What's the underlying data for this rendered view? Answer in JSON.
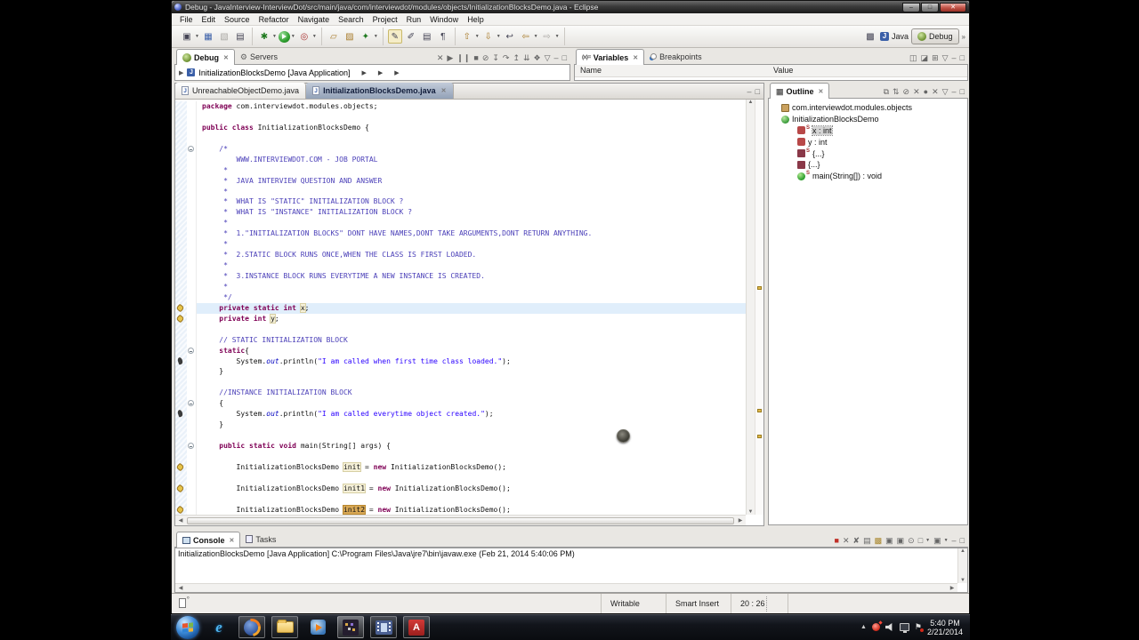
{
  "window": {
    "title": "Debug - JavaInterview-InterviewDot/src/main/java/com/interviewdot/modules/objects/InitializationBlocksDemo.java - Eclipse"
  },
  "menu_items": [
    "File",
    "Edit",
    "Source",
    "Refactor",
    "Navigate",
    "Search",
    "Project",
    "Run",
    "Window",
    "Help"
  ],
  "toolbar": {
    "perspective_java": "Java",
    "perspective_debug": "Debug",
    "overflow": "»"
  },
  "debug_panel": {
    "tab_debug": "Debug",
    "tab_servers": "Servers",
    "process_label": "InitializationBlocksDemo [Java Application]"
  },
  "variables_panel": {
    "tab_variables": "Variables",
    "tab_breakpoints": "Breakpoints",
    "col_name": "Name",
    "col_value": "Value"
  },
  "editor": {
    "tab_inactive": "UnreachableObjectDemo.java",
    "tab_active": "InitializationBlocksDemo.java",
    "code": {
      "markers": {
        "fold": [
          5,
          24,
          29,
          33
        ],
        "yellow": [
          20,
          21,
          35,
          37,
          39
        ],
        "dark": [
          25,
          30
        ],
        "current_line": 20
      },
      "lines": [
        {
          "n": 1,
          "seg": [
            [
              "k",
              "package"
            ],
            [
              "p",
              " com.interviewdot.modules.objects;"
            ]
          ]
        },
        {
          "n": 2,
          "seg": []
        },
        {
          "n": 3,
          "seg": [
            [
              "k",
              "public"
            ],
            [
              "p",
              " "
            ],
            [
              "k",
              "class"
            ],
            [
              "p",
              " InitializationBlocksDemo {"
            ]
          ]
        },
        {
          "n": 4,
          "seg": []
        },
        {
          "n": 5,
          "seg": [
            [
              "c",
              "    /*"
            ]
          ]
        },
        {
          "n": 6,
          "seg": [
            [
              "c",
              "        WWW.INTERVIEWDOT.COM - JOB PORTAL"
            ]
          ]
        },
        {
          "n": 7,
          "seg": [
            [
              "c",
              "     *"
            ]
          ]
        },
        {
          "n": 8,
          "seg": [
            [
              "c",
              "     *  JAVA INTERVIEW QUESTION AND ANSWER"
            ]
          ]
        },
        {
          "n": 9,
          "seg": [
            [
              "c",
              "     *"
            ]
          ]
        },
        {
          "n": 10,
          "seg": [
            [
              "c",
              "     *  WHAT IS \"STATIC\" INITIALIZATION BLOCK ?"
            ]
          ]
        },
        {
          "n": 11,
          "seg": [
            [
              "c",
              "     *  WHAT IS \"INSTANCE\" INITIALIZATION BLOCK ?"
            ]
          ]
        },
        {
          "n": 12,
          "seg": [
            [
              "c",
              "     *"
            ]
          ]
        },
        {
          "n": 13,
          "seg": [
            [
              "c",
              "     *  1.\"INITIALIZATION BLOCKS\" DONT HAVE NAMES,DONT TAKE ARGUMENTS,DONT RETURN ANYTHING."
            ]
          ]
        },
        {
          "n": 14,
          "seg": [
            [
              "c",
              "     *"
            ]
          ]
        },
        {
          "n": 15,
          "seg": [
            [
              "c",
              "     *  2.STATIC BLOCK RUNS ONCE,WHEN THE CLASS IS FIRST LOADED."
            ]
          ]
        },
        {
          "n": 16,
          "seg": [
            [
              "c",
              "     *"
            ]
          ]
        },
        {
          "n": 17,
          "seg": [
            [
              "c",
              "     *  3.INSTANCE BLOCK RUNS EVERYTIME A NEW INSTANCE IS CREATED."
            ]
          ]
        },
        {
          "n": 18,
          "seg": [
            [
              "c",
              "     *"
            ]
          ]
        },
        {
          "n": 19,
          "seg": [
            [
              "c",
              "     */"
            ]
          ]
        },
        {
          "n": 20,
          "seg": [
            [
              "p",
              "    "
            ],
            [
              "k",
              "private"
            ],
            [
              "p",
              " "
            ],
            [
              "k",
              "static"
            ],
            [
              "p",
              " "
            ],
            [
              "k",
              "int"
            ],
            [
              "p",
              " "
            ],
            [
              "occ",
              "x"
            ],
            [
              "p",
              ";"
            ]
          ]
        },
        {
          "n": 21,
          "seg": [
            [
              "p",
              "    "
            ],
            [
              "k",
              "private"
            ],
            [
              "p",
              " "
            ],
            [
              "k",
              "int"
            ],
            [
              "p",
              " "
            ],
            [
              "occ",
              "y"
            ],
            [
              "p",
              ";"
            ]
          ]
        },
        {
          "n": 22,
          "seg": []
        },
        {
          "n": 23,
          "seg": [
            [
              "c",
              "    // STATIC INITIALIZATION BLOCK"
            ]
          ]
        },
        {
          "n": 24,
          "seg": [
            [
              "p",
              "    "
            ],
            [
              "k",
              "static"
            ],
            [
              "p",
              "{"
            ]
          ]
        },
        {
          "n": 25,
          "seg": [
            [
              "p",
              "        System."
            ],
            [
              "i",
              "out"
            ],
            [
              "p",
              ".println("
            ],
            [
              "s",
              "\"I am called when first time class loaded.\""
            ],
            [
              "p",
              ");"
            ]
          ]
        },
        {
          "n": 26,
          "seg": [
            [
              "p",
              "    }"
            ]
          ]
        },
        {
          "n": 27,
          "seg": []
        },
        {
          "n": 28,
          "seg": [
            [
              "c",
              "    //INSTANCE INITIALIZATION BLOCK"
            ]
          ]
        },
        {
          "n": 29,
          "seg": [
            [
              "p",
              "    {"
            ]
          ]
        },
        {
          "n": 30,
          "seg": [
            [
              "p",
              "        System."
            ],
            [
              "i",
              "out"
            ],
            [
              "p",
              ".println("
            ],
            [
              "s",
              "\"I am called everytime object created.\""
            ],
            [
              "p",
              ");"
            ]
          ]
        },
        {
          "n": 31,
          "seg": [
            [
              "p",
              "    }"
            ]
          ]
        },
        {
          "n": 32,
          "seg": []
        },
        {
          "n": 33,
          "seg": [
            [
              "p",
              "    "
            ],
            [
              "k",
              "public"
            ],
            [
              "p",
              " "
            ],
            [
              "k",
              "static"
            ],
            [
              "p",
              " "
            ],
            [
              "k",
              "void"
            ],
            [
              "p",
              " main(String[] args) {"
            ]
          ]
        },
        {
          "n": 34,
          "seg": []
        },
        {
          "n": 35,
          "seg": [
            [
              "p",
              "        InitializationBlocksDemo "
            ],
            [
              "occ",
              "init"
            ],
            [
              "p",
              " = "
            ],
            [
              "k",
              "new"
            ],
            [
              "p",
              " InitializationBlocksDemo();"
            ]
          ]
        },
        {
          "n": 36,
          "seg": []
        },
        {
          "n": 37,
          "seg": [
            [
              "p",
              "        InitializationBlocksDemo "
            ],
            [
              "occ",
              "init1"
            ],
            [
              "p",
              " = "
            ],
            [
              "k",
              "new"
            ],
            [
              "p",
              " InitializationBlocksDemo();"
            ]
          ]
        },
        {
          "n": 38,
          "seg": []
        },
        {
          "n": 39,
          "seg": [
            [
              "p",
              "        InitializationBlocksDemo "
            ],
            [
              "sel",
              "init2"
            ],
            [
              "p",
              " = "
            ],
            [
              "k",
              "new"
            ],
            [
              "p",
              " InitializationBlocksDemo();"
            ]
          ]
        }
      ]
    }
  },
  "outline_panel": {
    "tab": "Outline",
    "items": [
      {
        "icon": "package",
        "label": "com.interviewdot.modules.objects",
        "indent": 0,
        "static": false,
        "selected": false
      },
      {
        "icon": "class",
        "label": "InitializationBlocksDemo",
        "indent": 0,
        "static": false,
        "selected": false
      },
      {
        "icon": "field",
        "label": "x : int",
        "indent": 1,
        "static": true,
        "selected": true
      },
      {
        "icon": "field",
        "label": "y : int",
        "indent": 1,
        "static": false,
        "selected": false
      },
      {
        "icon": "init",
        "label": "{...}",
        "indent": 1,
        "static": true,
        "selected": false
      },
      {
        "icon": "init",
        "label": "{...}",
        "indent": 1,
        "static": false,
        "selected": false
      },
      {
        "icon": "method",
        "label": "main(String[]) : void",
        "indent": 1,
        "static": true,
        "selected": false
      }
    ]
  },
  "console_panel": {
    "tab_console": "Console",
    "tab_tasks": "Tasks",
    "message": "InitializationBlocksDemo [Java Application] C:\\Program Files\\Java\\jre7\\bin\\javaw.exe (Feb 21, 2014 5:40:06 PM)"
  },
  "status_bar": {
    "writable": "Writable",
    "insert_mode": "Smart Insert",
    "cursor_position": "20 : 26"
  },
  "taskbar": {
    "clock_time": "5:40 PM",
    "clock_date": "2/21/2014"
  },
  "colors": {
    "keyword": "#7f0055",
    "comment": "#4a3fb8",
    "string": "#2a00ff",
    "selection": "#d8a855",
    "current_line": "#e0eefb"
  }
}
